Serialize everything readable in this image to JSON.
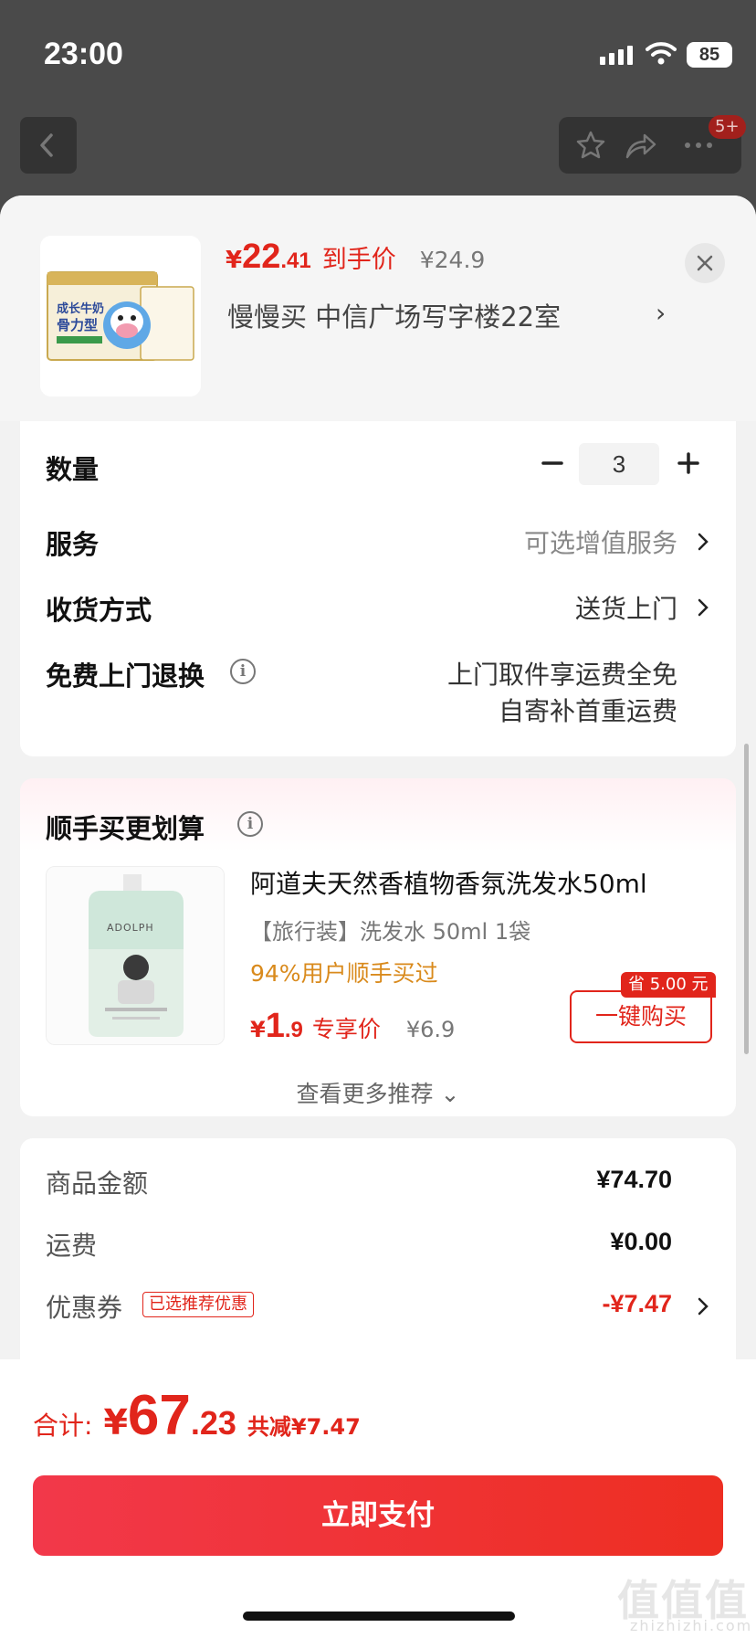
{
  "status_bar": {
    "time": "23:00",
    "battery": "85"
  },
  "background_page": {
    "cart_badge": "5+"
  },
  "header": {
    "price_yen": "¥",
    "price_int": "22",
    "price_dec": ".41",
    "price_label": "到手价",
    "original_price": "¥24.9",
    "address": "慢慢买  中信广场写字楼22室",
    "address_chevron": "›",
    "image_text": [
      "成长牛奶",
      "骨力型"
    ]
  },
  "options": {
    "quantity": {
      "label": "数量",
      "value": "3"
    },
    "service": {
      "label": "服务",
      "value": "可选增值服务"
    },
    "delivery": {
      "label": "收货方式",
      "value": "送货上门"
    },
    "return": {
      "label": "免费上门退换",
      "line1": "上门取件享运费全免",
      "line2": "自寄补首重运费"
    }
  },
  "recommendation": {
    "title": "顺手买更划算",
    "product_title": "阿道夫天然香植物香氛洗发水50ml",
    "product_sub": "【旅行装】洗发水 50ml 1袋",
    "social": "94%用户顺手买过",
    "price_yen": "¥",
    "price_int": "1",
    "price_dec": ".9",
    "price_label": "专享价",
    "original_price": "¥6.9",
    "save_tag": "省 5.00 元",
    "buy_button": "一键购买",
    "more": "查看更多推荐 ⌄",
    "image_brand": "ADOLPH"
  },
  "summary": {
    "items": [
      {
        "label": "商品金额",
        "value": "¥74.70"
      },
      {
        "label": "运费",
        "value": "¥0.00"
      },
      {
        "label": "优惠券",
        "value": "-¥7.47",
        "tag": "已选推荐优惠"
      }
    ]
  },
  "footer": {
    "total_label": "合计:",
    "total_yen": "¥",
    "total_int": "67",
    "total_dec": ".23",
    "total_save": "共减¥7.47",
    "pay_button": "立即支付",
    "watermark": "值值值",
    "watermark_sub": "zhizhizhi.com"
  },
  "colors": {
    "accent": "#e1251b",
    "pay_button": "#ef3430",
    "social": "#d98a1c"
  }
}
